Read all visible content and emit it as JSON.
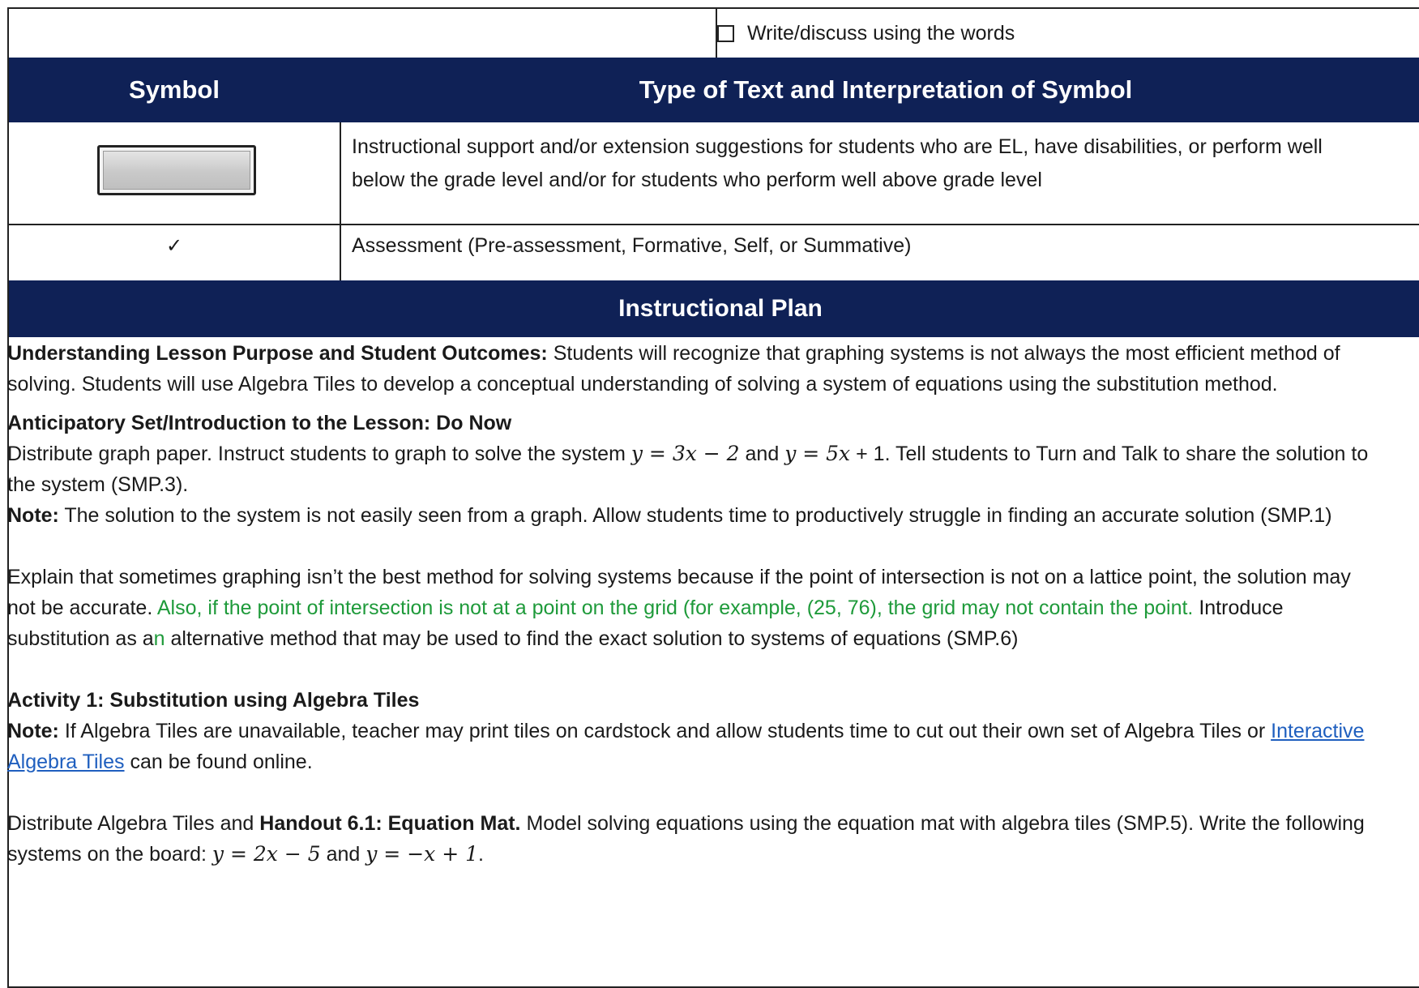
{
  "top_row": {
    "checkbox_label": "Write/discuss using the words"
  },
  "symbol_table": {
    "header_symbol": "Symbol",
    "header_type": "Type of Text and Interpretation of Symbol",
    "row1_icon": "gray-button-icon",
    "row1_text": "Instructional support and/or extension suggestions for students who are EL, have disabilities, or perform well below the grade level and/or for students who perform well above grade level",
    "row2_symbol": "✓",
    "row2_text": "Assessment (Pre-assessment, Formative, Self, or Summative)"
  },
  "plan": {
    "title": "Instructional Plan",
    "purpose_heading": "Understanding Lesson Purpose and Student Outcomes:",
    "purpose_text": " Students will recognize that graphing systems is not always the most efficient method of solving. Students will use Algebra Tiles to develop a conceptual understanding of solving a system of equations using the substitution method.",
    "anticipatory_heading": "Anticipatory Set/Introduction to the Lesson: Do Now",
    "anticipatory_p1": "Distribute graph paper. Instruct students to graph to solve the system ",
    "eq1": "y = 3x − 2",
    "and1": " and ",
    "eq2": "y = 5x",
    "anticipatory_p1_end": " + 1. Tell students to Turn and Talk to share the solution to the system (SMP.3).",
    "note_label": "Note:",
    "note1_text": " The solution to the system is not easily seen from a graph. Allow students time to productively struggle in finding an accurate solution (SMP.1)",
    "explain_text": "Explain that sometimes graphing isn’t the best method for solving systems because if the point of intersection is not on a lattice point, the solution may not be accurate. ",
    "explain_green": "Also, if the point of intersection is not at a point on the grid (for example, (25, 76), the grid may not contain the point.",
    "explain_rest_a": " Introduce substitution as a",
    "explain_green_n": "n",
    "explain_rest_b": " alternative method that may be used to find the exact solution to systems of equations (SMP.6)",
    "activity_heading": "Activity 1: Substitution using Algebra Tiles",
    "note2_text": " If Algebra Tiles are unavailable, teacher may print tiles on cardstock and allow students time to cut out their own set of Algebra Tiles or ",
    "note2_link": "Interactive Algebra Tiles",
    "note2_end": " can be found online.",
    "distribute_a": "Distribute Algebra Tiles and ",
    "distribute_bold": "Handout 6.1: Equation Mat.",
    "distribute_b": " Model solving equations using the equation mat with algebra tiles (SMP.5). Write the following systems on the board: ",
    "eq3": "y = 2x − 5",
    "and2": " and ",
    "eq4": "y = −x + 1",
    "period": "."
  },
  "colors": {
    "header_navy": "#0f2156",
    "green_text": "#1e9a3a",
    "link_blue": "#1f5fbf"
  }
}
